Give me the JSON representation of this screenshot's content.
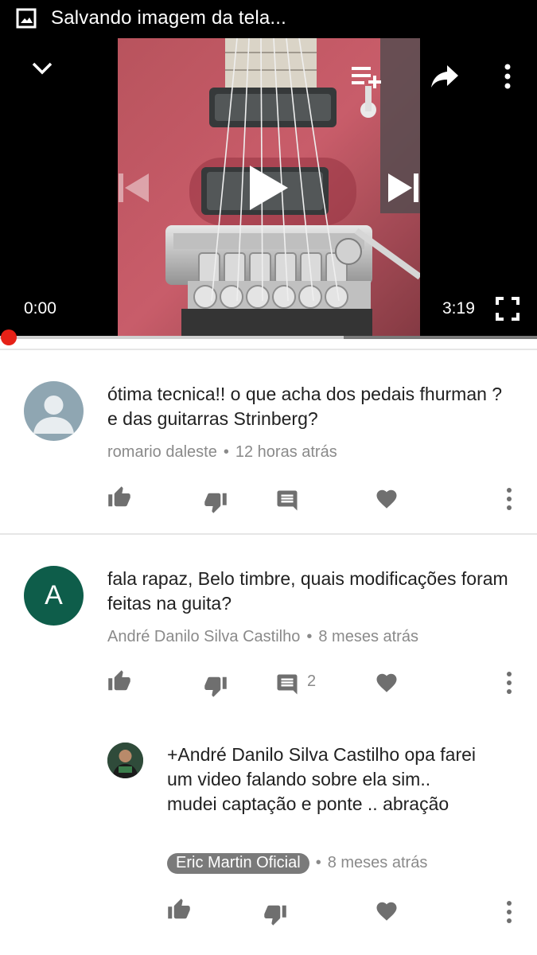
{
  "status_bar": {
    "notification_icon": "image-icon",
    "title": "Salvando imagem da tela..."
  },
  "player": {
    "current_time": "0:00",
    "duration": "3:19",
    "progress": 0.0,
    "buffered": 0.64,
    "icons": [
      "chevron-down-icon",
      "add-to-playlist-icon",
      "share-icon",
      "more-vert-icon",
      "previous-icon",
      "play-icon",
      "next-icon",
      "fullscreen-icon"
    ]
  },
  "comments": [
    {
      "text": "ótima tecnica!! o que acha dos pedais fhurman ? e das guitarras Strinberg?",
      "author": "romario daleste",
      "time": "12 horas atrás",
      "avatar": {
        "type": "default",
        "color": "#8fa6b2"
      }
    },
    {
      "text": "fala rapaz,  Belo timbre, quais modificações foram feitas na guita?",
      "author": "André Danilo Silva Castilho",
      "time": "8 meses atrás",
      "reply_count": "2",
      "avatar": {
        "type": "letter",
        "letter": "A",
        "color": "#0e5d4a"
      }
    }
  ],
  "reply": {
    "text": "+André Danilo Silva Castilho  opa farei um video falando sobre ela sim.. mudei captação e ponte .. abração",
    "author": "Eric Martin Oficial",
    "time": "8 meses atrás"
  },
  "separator": "•",
  "colors": {
    "progress": "#e62117",
    "meta": "#8a8a8a",
    "icon": "#6f6f6f"
  }
}
